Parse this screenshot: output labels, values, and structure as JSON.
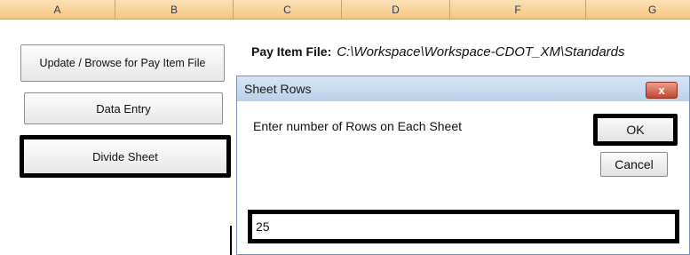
{
  "columns": [
    "A",
    "B",
    "C",
    "D",
    "F",
    "G"
  ],
  "buttons": {
    "update": "Update / Browse for Pay Item File",
    "data_entry": "Data Entry",
    "divide": "Divide Sheet"
  },
  "pay_item": {
    "label": "Pay Item File:",
    "path": "C:\\Workspace\\Workspace-CDOT_XM\\Standards"
  },
  "dialog": {
    "title": "Sheet Rows",
    "close": "x",
    "prompt": "Enter number of Rows on Each Sheet",
    "ok": "OK",
    "cancel": "Cancel",
    "value": "25"
  },
  "colors": {
    "header": "#f5c77f",
    "titlebar": "#b8d0ea",
    "close": "#c2452e",
    "highlight": "#000000"
  }
}
